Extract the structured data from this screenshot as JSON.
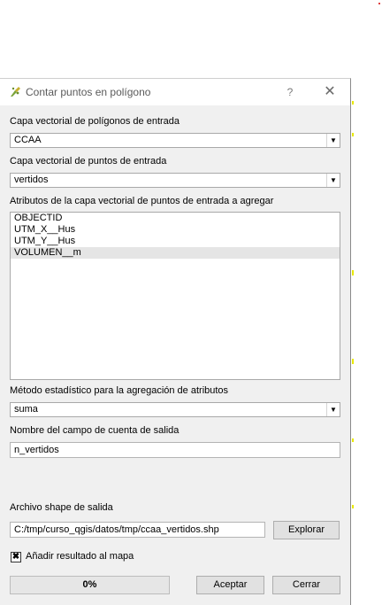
{
  "dialog": {
    "title": "Contar puntos en polígono",
    "help_symbol": "?",
    "close_symbol": "✕"
  },
  "polygon_layer": {
    "label": "Capa vectorial de polígonos de entrada",
    "value": "CCAA"
  },
  "point_layer": {
    "label": "Capa vectorial de puntos de entrada",
    "value": "vertidos"
  },
  "attributes": {
    "label": "Atributos de la capa vectorial de puntos de entrada a agregar",
    "items": [
      "OBJECTID",
      "UTM_X__Hus",
      "UTM_Y__Hus",
      "VOLUMEN__m"
    ],
    "selected_index": 3
  },
  "statistic": {
    "label": "Método estadístico para la agregación de atributos",
    "value": "suma"
  },
  "count_field": {
    "label": "Nombre del campo de cuenta de salida",
    "value": "n_vertidos"
  },
  "output": {
    "label": "Archivo shape de salida",
    "path": "C:/tmp/curso_qgis/datos/tmp/ccaa_vertidos.shp",
    "browse_label": "Explorar"
  },
  "add_to_map": {
    "label": "Añadir resultado al mapa",
    "checked": true,
    "check_symbol": "✖"
  },
  "progress": {
    "text": "0%",
    "value": 0
  },
  "buttons": {
    "accept": "Aceptar",
    "cancel": "Cerrar"
  },
  "icons": {
    "combo_arrow": "▼",
    "window_icon": "qgis-processing-icon"
  },
  "colors": {
    "progress_fill": "#06b025",
    "background_marks": "#e8e800"
  }
}
